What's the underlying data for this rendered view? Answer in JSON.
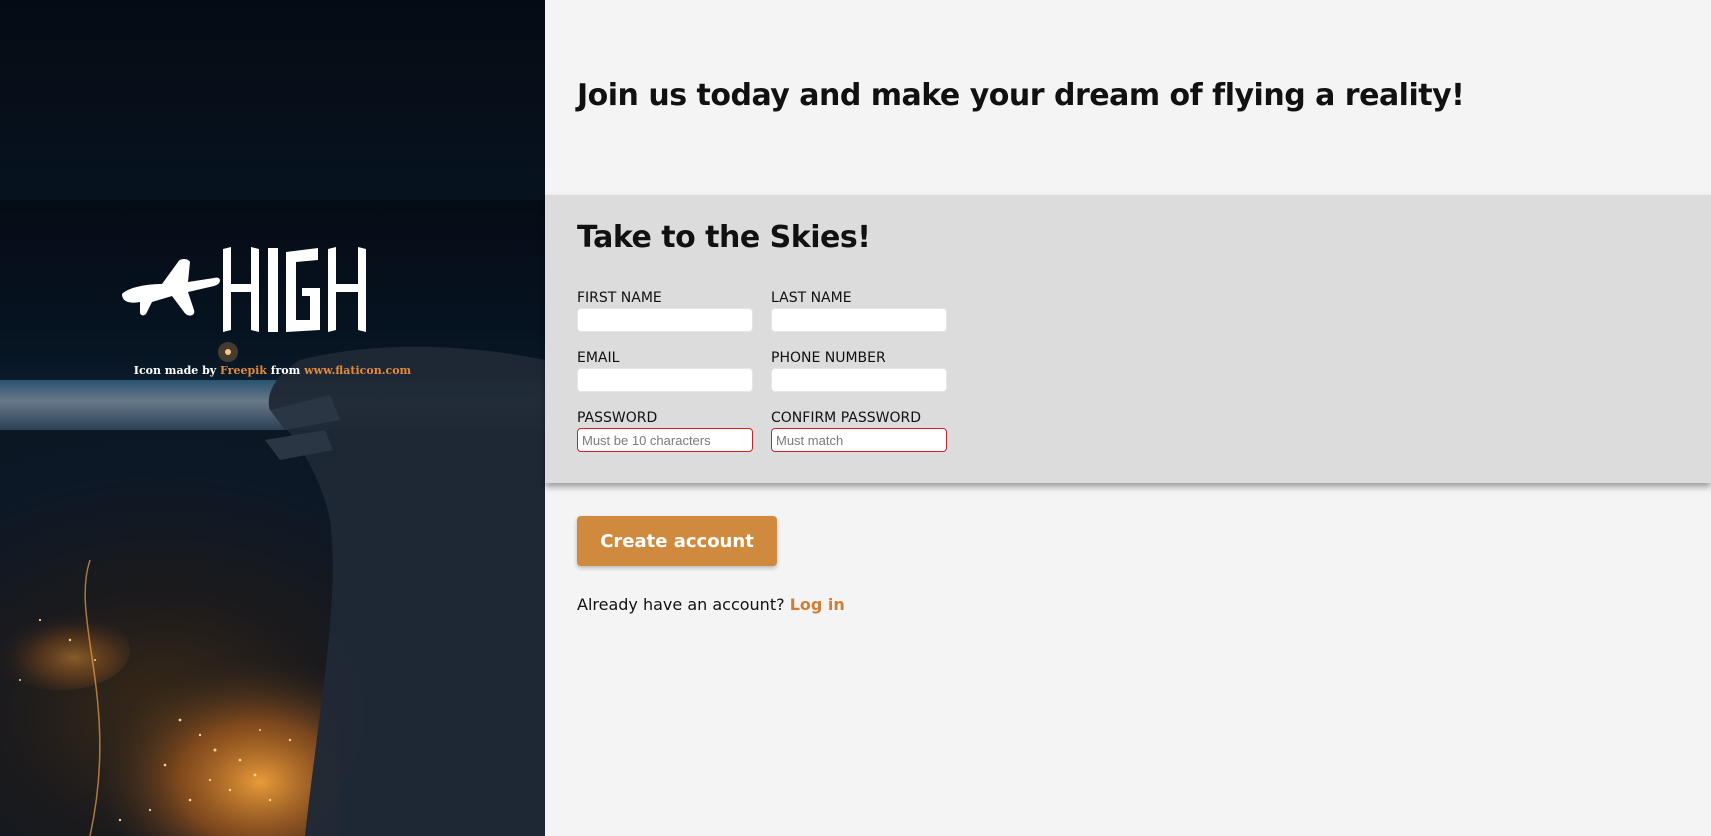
{
  "hero": {
    "logo_text": "HIGH",
    "attribution": {
      "prefix": "Icon made by",
      "author_link": "Freepik",
      "middle": "from",
      "site_link": "www.flaticon.com"
    }
  },
  "main": {
    "headline": "Join us today and make your dream of flying a reality!",
    "form": {
      "title": "Take to the Skies!",
      "fields": {
        "first_name": {
          "label": "First Name",
          "placeholder": "",
          "value": ""
        },
        "last_name": {
          "label": "Last Name",
          "placeholder": "",
          "value": ""
        },
        "email": {
          "label": "Email",
          "placeholder": "",
          "value": ""
        },
        "phone": {
          "label": "Phone Number",
          "placeholder": "",
          "value": ""
        },
        "password": {
          "label": "Password",
          "placeholder": "Must be 10 characters",
          "value": ""
        },
        "confirm_password": {
          "label": "Confirm Password",
          "placeholder": "Must match",
          "value": ""
        }
      }
    },
    "create_button": "Create account",
    "login_prompt": "Already have an account?",
    "login_link": "Log in"
  },
  "colors": {
    "accent": "#cf8a3e",
    "link": "#cf7f35",
    "invalid_border": "#d2202a",
    "form_panel": "#dcdcdc",
    "page_bg": "#f4f4f4"
  },
  "icons": {
    "logo": "airplane-icon"
  }
}
